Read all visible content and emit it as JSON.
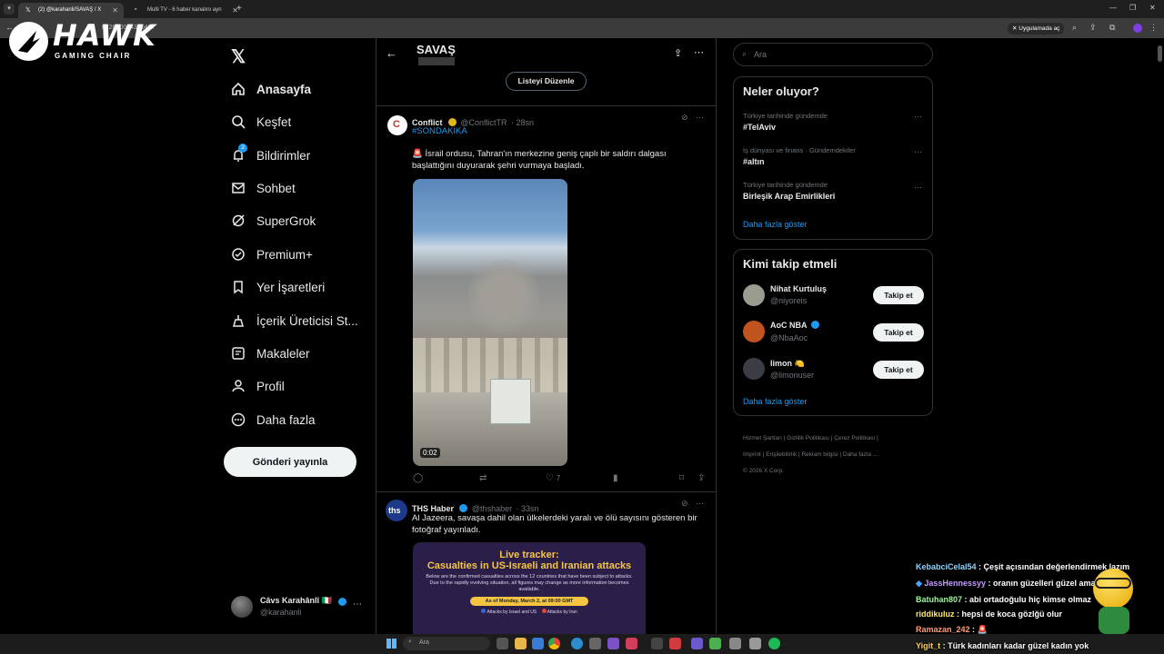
{
  "browser": {
    "tabs": [
      {
        "title": "(2) @karahanli/SAVAŞ / X",
        "active": true
      },
      {
        "title": "Multi TV - 6 haber kanalını ayn",
        "active": false
      }
    ],
    "url": "822690074300467",
    "app_pill": "Uygulamada aç"
  },
  "overlay_logo": {
    "brand": "HAWK",
    "tagline": "GAMING CHAIR"
  },
  "nav": {
    "items": [
      {
        "label": "Anasayfa",
        "icon": "home-icon"
      },
      {
        "label": "Keşfet",
        "icon": "search-icon"
      },
      {
        "label": "Bildirimler",
        "icon": "bell-icon",
        "badge": "2"
      },
      {
        "label": "Sohbet",
        "icon": "mail-icon"
      },
      {
        "label": "SuperGrok",
        "icon": "grok-icon"
      },
      {
        "label": "Premium+",
        "icon": "premium-icon"
      },
      {
        "label": "Yer İşaretleri",
        "icon": "bookmark-icon"
      },
      {
        "label": "İçerik Üreticisi St...",
        "icon": "creator-icon"
      },
      {
        "label": "Makaleler",
        "icon": "article-icon"
      },
      {
        "label": "Profil",
        "icon": "profile-icon"
      },
      {
        "label": "Daha fazla",
        "icon": "more-circle-icon"
      }
    ],
    "post_button": "Gönderi yayınla",
    "account": {
      "name": "Câvs Karahânlî 🇮🇹",
      "handle": "@karahanli"
    }
  },
  "header": {
    "title": "SAVAŞ",
    "edit_list_button": "Listeyi Düzenle"
  },
  "tweets": [
    {
      "name": "Conflict",
      "handle": "@ConflictTR",
      "time": "· 28sn",
      "hashtag": "#SONDAKİKA",
      "text": "🚨 İsrail ordusu, Tahran'ın merkezine geniş çaplı bir saldırı dalgası başlattığını duyurarak şehri vurmaya başladı.",
      "video_duration": "0:02",
      "likes": "7"
    },
    {
      "name": "THS Haber",
      "handle": "@thshaber",
      "time": "· 33sn",
      "text": "Al Jazeera, savaşa dahil olan ülkelerdeki yaralı ve ölü sayısını gösteren bir fotoğraf yayınladı.",
      "image": {
        "title": "Live tracker:",
        "subtitle": "Casualties in US-Israeli and Iranian attacks",
        "body": "Below are the confirmed casualties across the 12 countries that have been subject to attacks. Due to the rapidly evolving situation, all figures may change as more information becomes available.",
        "date": "As of Monday, March 2, at 09:00 GMT",
        "legend_a": "Attacks by Israel and US",
        "legend_b": "Attacks by Iran"
      }
    }
  ],
  "right": {
    "search_placeholder": "Ara",
    "trends_title": "Neler oluyor?",
    "trends": [
      {
        "category": "Türkiye tarihinde gündemde",
        "name": "#TelAviv"
      },
      {
        "category": "İş dünyası ve finans · Gündemdekiler",
        "name": "#altın"
      },
      {
        "category": "Türkiye tarihinde gündemde",
        "name": "Birleşik Arap Emirlikleri"
      }
    ],
    "show_more": "Daha fazla göster",
    "who_to_follow_title": "Kimi takip etmeli",
    "follow": [
      {
        "name": "Nihat Kurtuluş",
        "handle": "@niyoreis",
        "button": "Takip et"
      },
      {
        "name": "AoC NBA",
        "handle": "@NbaAoc",
        "button": "Takip et"
      },
      {
        "name": "limon 🍋",
        "handle": "@limonuser",
        "button": "Takip et"
      }
    ],
    "show_more_2": "Daha fazla göster",
    "footer": [
      "Hizmet Şartları",
      "Gizlilik Politikası",
      "Çerez Politikası",
      "Imprint",
      "Erişilebilirlik",
      "Reklam bilgisi",
      "Daha fazla ...",
      "© 2026 X Corp."
    ]
  },
  "chat": [
    {
      "user": "KebabciCelal54",
      "msg": " : Çeşit açısından değerlendirmek lazım",
      "color": "#8fd3ff"
    },
    {
      "user": "JassHennessyy",
      "msg": " : oranın güzelleri güzel ama",
      "color": "#c59bff"
    },
    {
      "user": "Batuhan807",
      "msg": " : abi ortadoğulu hiç kimse olmaz",
      "color": "#9cf59c"
    },
    {
      "user": "riddikuluz",
      "msg": " : hepsi de koca gözlğü olur",
      "color": "#ffe97a"
    },
    {
      "user": "Ramazan_242",
      "msg": " : 🚨",
      "color": "#ff9e7a"
    },
    {
      "user": "Yigit_t",
      "msg": " : Türk kadınları kadar güzel kadın yok",
      "color": "#ffd34f"
    }
  ],
  "taskbar": {
    "search": "Ara"
  }
}
